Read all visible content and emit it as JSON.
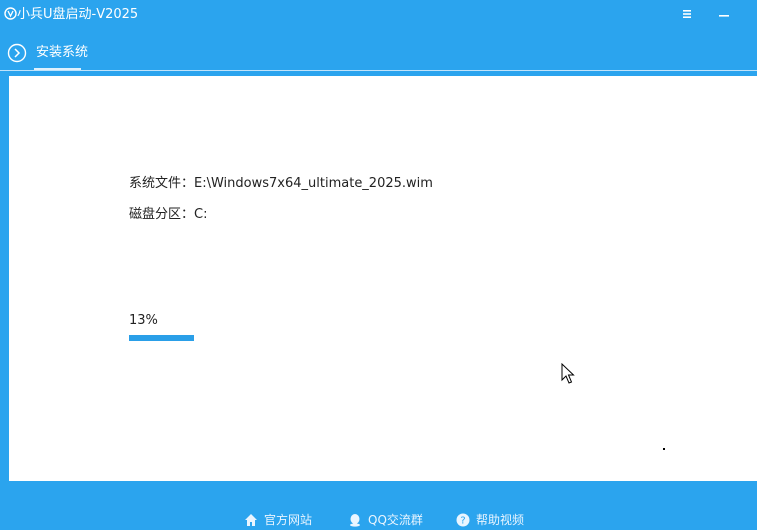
{
  "window": {
    "title": "小兵U盘启动-V2025",
    "icons": {
      "logo": "app-logo-icon",
      "menu": "menu-icon",
      "minimize": "minimize-icon"
    }
  },
  "tab": {
    "label": "安装系统",
    "icon": "chevron-right-circle-icon"
  },
  "install": {
    "file_label": "系统文件：",
    "file_value": "E:\\Windows7x64_ultimate_2025.wim",
    "partition_label": "磁盘分区：",
    "partition_value": "C:",
    "progress_text": "13%",
    "progress": 0.13
  },
  "footer": {
    "links": [
      {
        "label": "官方网站",
        "icon": "home-icon"
      },
      {
        "label": "QQ交流群",
        "icon": "qq-penguin-icon"
      },
      {
        "label": "帮助视频",
        "icon": "help-circle-icon"
      }
    ]
  },
  "colors": {
    "accent": "#2ba4ee",
    "progress": "#2a9fe8",
    "content_bg": "#ffffff"
  }
}
